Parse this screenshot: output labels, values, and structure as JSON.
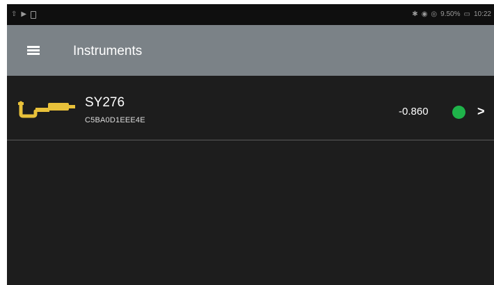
{
  "app": {
    "title": "Instruments"
  },
  "status_bar": {
    "right_text": "10:22",
    "battery_text": "9.50%"
  },
  "instruments": [
    {
      "name": "SY276",
      "id": "C5BA0D1EEE4E",
      "value": "-0.860",
      "status": "connected",
      "status_color": "#1fb34a",
      "icon": "micrometer-icon",
      "chevron": ">"
    }
  ],
  "colors": {
    "app_bar": "#7b8287",
    "background": "#1d1d1d",
    "icon": "#e8c13a"
  }
}
